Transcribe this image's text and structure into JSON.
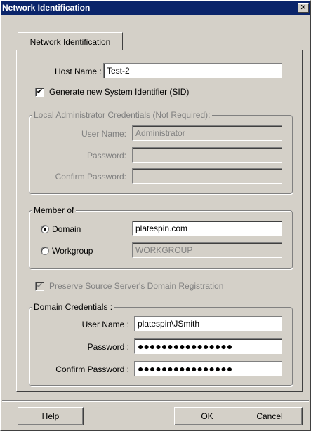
{
  "window": {
    "title": "Network Identification",
    "close_glyph": "✕"
  },
  "tabs": [
    {
      "label": "Network Identification"
    }
  ],
  "host": {
    "label": "Host Name :",
    "value": "Test-2"
  },
  "sid": {
    "label": "Generate new System Identifier (SID)",
    "checked": true
  },
  "local_admin": {
    "legend": "Local Administrator Credentials (Not Required):",
    "user_label": "User Name:",
    "user_value": "Administrator",
    "password_label": "Password:",
    "password_value": "",
    "confirm_label": "Confirm Password:",
    "confirm_value": ""
  },
  "member_of": {
    "legend": "Member of",
    "domain_label": "Domain",
    "domain_value": "platespin.com",
    "domain_selected": true,
    "workgroup_label": "Workgroup",
    "workgroup_value": "WORKGROUP"
  },
  "preserve": {
    "label": "Preserve Source Server's Domain Registration",
    "checked": true,
    "enabled": false
  },
  "domain_creds": {
    "legend": "Domain Credentials :",
    "user_label": "User Name :",
    "user_value": "platespin\\JSmith",
    "password_label": "Password :",
    "password_value": "●●●●●●●●●●●●●●●●",
    "confirm_label": "Confirm Password :",
    "confirm_value": "●●●●●●●●●●●●●●●●"
  },
  "buttons": {
    "help": "Help",
    "ok": "OK",
    "cancel": "Cancel"
  },
  "icons": {
    "close": "close-icon",
    "checkmark": "checkmark-icon",
    "radio": "radio-dot-icon"
  }
}
